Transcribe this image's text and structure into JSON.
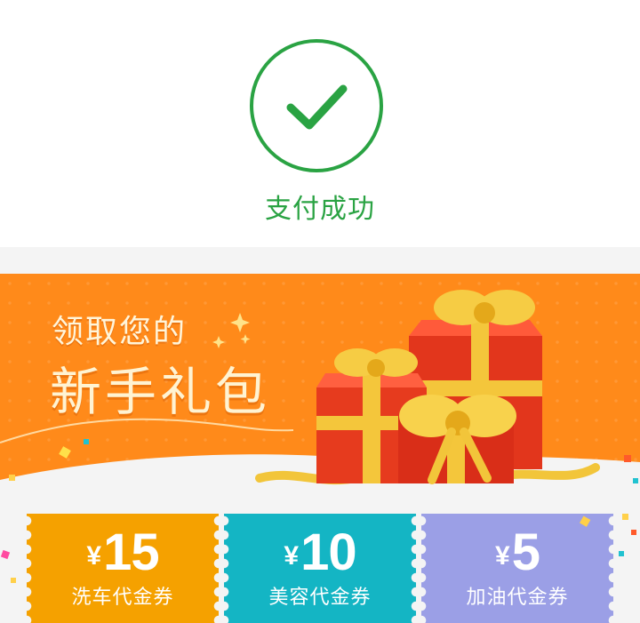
{
  "status": {
    "text": "支付成功",
    "color": "#2aa343",
    "icon": "check-circle-icon"
  },
  "banner": {
    "line1": "领取您的",
    "line2": "新手礼包",
    "background": "#ff8a1a",
    "art": "gift-boxes-illustration"
  },
  "coupons": [
    {
      "currency": "¥",
      "amount": "15",
      "label": "洗车代金券",
      "color": "#f5a100"
    },
    {
      "currency": "¥",
      "amount": "10",
      "label": "美容代金券",
      "color": "#14b5c4"
    },
    {
      "currency": "¥",
      "amount": "5",
      "label": "加油代金券",
      "color": "#9b9fe6"
    }
  ]
}
